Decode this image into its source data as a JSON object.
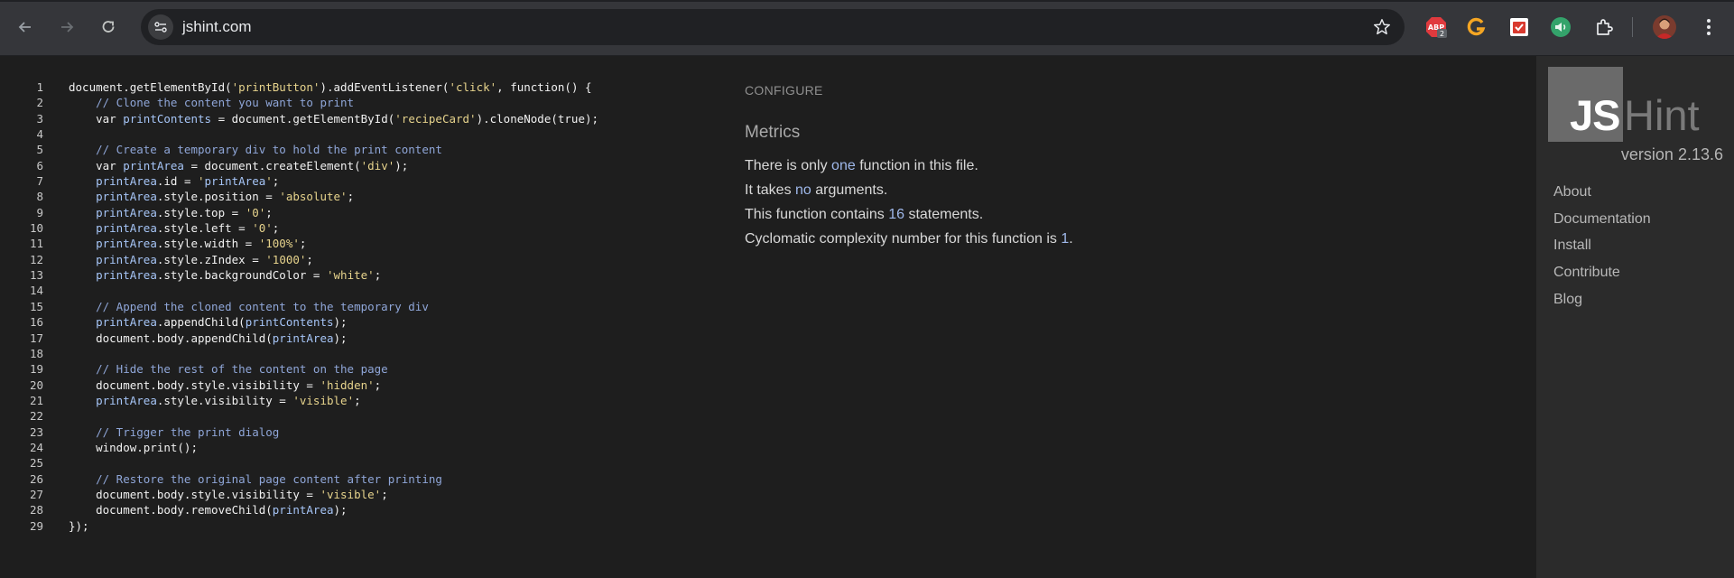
{
  "browser": {
    "url": "jshint.com",
    "extensions": [
      {
        "name": "adblock",
        "badge": "2"
      },
      {
        "name": "grammarly"
      },
      {
        "name": "todoist"
      },
      {
        "name": "volume"
      },
      {
        "name": "extensions"
      }
    ]
  },
  "editor": {
    "lines": [
      {
        "n": "1",
        "html": "document.getElementById('printButton').addEventListener('click', function() {"
      },
      {
        "n": "2",
        "html": "    // Clone the content you want to print",
        "t": "com"
      },
      {
        "n": "3",
        "html": "    var printContents = document.getElementById('recipeCard').cloneNode(true);"
      },
      {
        "n": "4",
        "html": ""
      },
      {
        "n": "5",
        "html": "    // Create a temporary div to hold the print content",
        "t": "com"
      },
      {
        "n": "6",
        "html": "    var printArea = document.createElement('div');"
      },
      {
        "n": "7",
        "html": "    printArea.id = 'printArea';"
      },
      {
        "n": "8",
        "html": "    printArea.style.position = 'absolute';"
      },
      {
        "n": "9",
        "html": "    printArea.style.top = '0';"
      },
      {
        "n": "10",
        "html": "    printArea.style.left = '0';"
      },
      {
        "n": "11",
        "html": "    printArea.style.width = '100%';"
      },
      {
        "n": "12",
        "html": "    printArea.style.zIndex = '1000';"
      },
      {
        "n": "13",
        "html": "    printArea.style.backgroundColor = 'white';"
      },
      {
        "n": "14",
        "html": ""
      },
      {
        "n": "15",
        "html": "    // Append the cloned content to the temporary div",
        "t": "com"
      },
      {
        "n": "16",
        "html": "    printArea.appendChild(printContents);"
      },
      {
        "n": "17",
        "html": "    document.body.appendChild(printArea);"
      },
      {
        "n": "18",
        "html": ""
      },
      {
        "n": "19",
        "html": "    // Hide the rest of the content on the page",
        "t": "com"
      },
      {
        "n": "20",
        "html": "    document.body.style.visibility = 'hidden';"
      },
      {
        "n": "21",
        "html": "    printArea.style.visibility = 'visible';"
      },
      {
        "n": "22",
        "html": ""
      },
      {
        "n": "23",
        "html": "    // Trigger the print dialog",
        "t": "com"
      },
      {
        "n": "24",
        "html": "    window.print();"
      },
      {
        "n": "25",
        "html": ""
      },
      {
        "n": "26",
        "html": "    // Restore the original page content after printing",
        "t": "com"
      },
      {
        "n": "27",
        "html": "    document.body.style.visibility = 'visible';"
      },
      {
        "n": "28",
        "html": "    document.body.removeChild(printArea);"
      },
      {
        "n": "29",
        "html": "});"
      }
    ]
  },
  "report": {
    "configure_label": "CONFIGURE",
    "metrics_title": "Metrics",
    "metrics": [
      {
        "pre": "There is only ",
        "hl": "one",
        "post": " function in this file."
      },
      {
        "pre": "It takes ",
        "hl": "no",
        "post": " arguments."
      },
      {
        "pre": "This function contains ",
        "hl": "16",
        "post": " statements."
      },
      {
        "pre": "Cyclomatic complexity number for this function is ",
        "hl": "1",
        "post": "."
      }
    ]
  },
  "sidebar": {
    "logo_js": "JS",
    "logo_hint": "Hint",
    "version": "version 2.13.6",
    "links": [
      "About",
      "Documentation",
      "Install",
      "Contribute",
      "Blog"
    ]
  },
  "colors": {
    "comment": "#8fa6d8",
    "variable": "#a6c5f7",
    "string": "#e6d38c",
    "highlight": "#9fb8ea"
  }
}
